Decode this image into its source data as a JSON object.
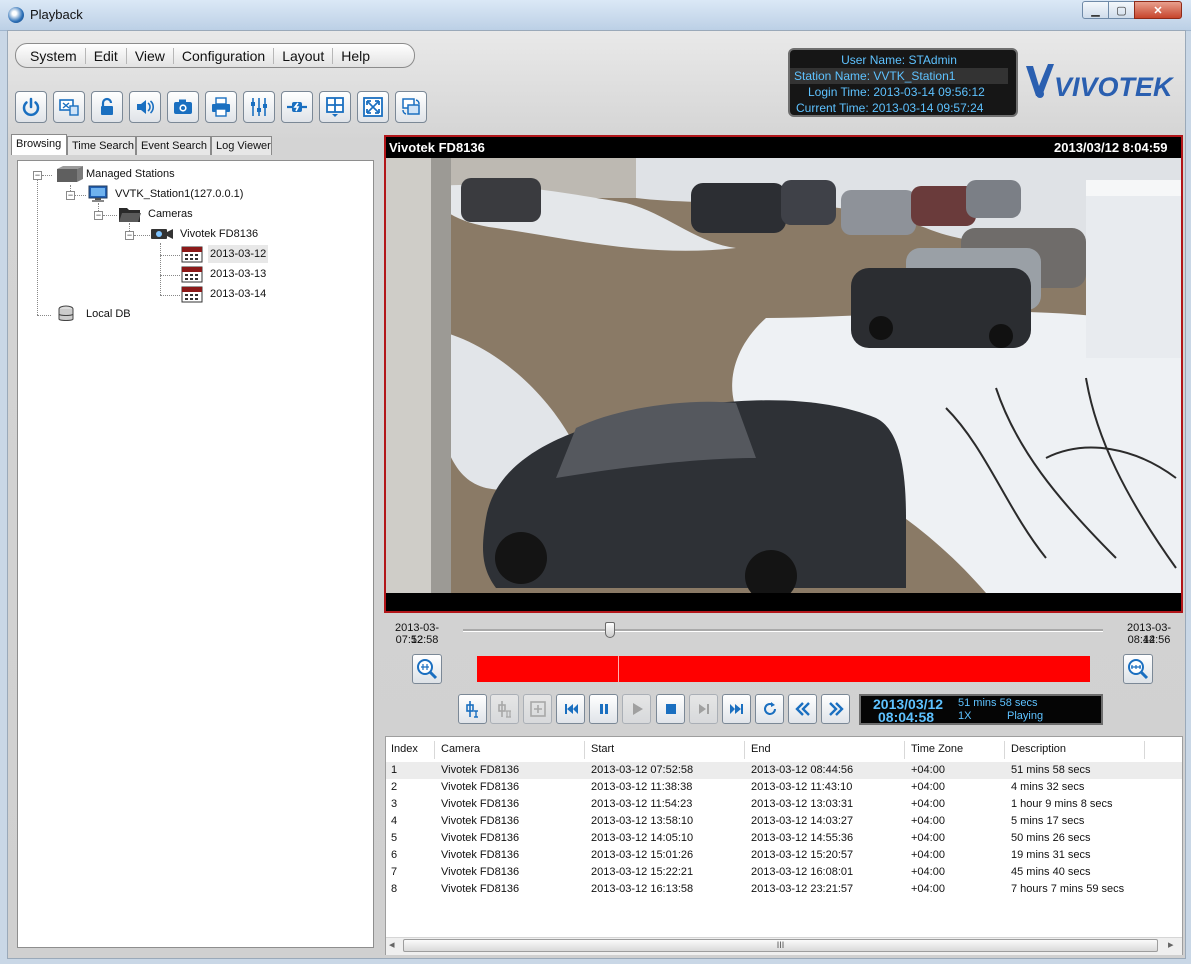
{
  "window": {
    "title": "Playback",
    "close_glyph": "✕",
    "min_glyph": "▁",
    "max_glyph": "▢"
  },
  "menu": [
    "System",
    "Edit",
    "View",
    "Configuration",
    "Layout",
    "Help"
  ],
  "toolbar_icons": [
    "power-icon",
    "station-icon",
    "lock-icon",
    "speaker-icon",
    "camera-icon",
    "print-icon",
    "filter-icon",
    "connect-icon",
    "layout-icon",
    "fullscreen-icon",
    "sync-icon"
  ],
  "user_info": {
    "user_name": "User Name: STAdmin",
    "station_name": "Station Name: VVTK_Station1",
    "login_time": "Login Time: 2013-03-14 09:56:12",
    "current_time": "Current Time: 2013-03-14 09:57:24"
  },
  "brand": {
    "name": "VIVOTEK",
    "color": "#2a5fb0"
  },
  "left_tabs": [
    "Browsing",
    "Time Search",
    "Event Search",
    "Log Viewer"
  ],
  "tree": {
    "root": "Managed Stations",
    "station": "VVTK_Station1(127.0.0.1)",
    "cameras": "Cameras",
    "camera": "Vivotek FD8136",
    "dates": [
      "2013-03-12",
      "2013-03-13",
      "2013-03-14"
    ],
    "local_db": "Local DB"
  },
  "video": {
    "camera_name": "Vivotek FD8136",
    "timestamp": "2013/03/12 8:04:59"
  },
  "timeline": {
    "start_date": "2013-03-12",
    "start_time": "07:52:58",
    "end_date": "2013-03-12",
    "end_time": "08:44:56",
    "position_fraction": 0.23
  },
  "playback_status": {
    "date": "2013/03/12",
    "time": "08:04:58",
    "duration": "51 mins 58 secs",
    "speed": "1X",
    "state": "Playing"
  },
  "table": {
    "columns": [
      "Index",
      "Camera",
      "Start",
      "End",
      "Time Zone",
      "Description"
    ],
    "rows": [
      [
        "1",
        "Vivotek FD8136",
        "2013-03-12 07:52:58",
        "2013-03-12 08:44:56",
        "+04:00",
        "51 mins 58 secs"
      ],
      [
        "2",
        "Vivotek FD8136",
        "2013-03-12 11:38:38",
        "2013-03-12 11:43:10",
        "+04:00",
        "4 mins 32 secs"
      ],
      [
        "3",
        "Vivotek FD8136",
        "2013-03-12 11:54:23",
        "2013-03-12 13:03:31",
        "+04:00",
        "1 hour 9 mins 8 secs"
      ],
      [
        "4",
        "Vivotek FD8136",
        "2013-03-12 13:58:10",
        "2013-03-12 14:03:27",
        "+04:00",
        "5 mins 17 secs"
      ],
      [
        "5",
        "Vivotek FD8136",
        "2013-03-12 14:05:10",
        "2013-03-12 14:55:36",
        "+04:00",
        "50 mins 26 secs"
      ],
      [
        "6",
        "Vivotek FD8136",
        "2013-03-12 15:01:26",
        "2013-03-12 15:20:57",
        "+04:00",
        "19 mins 31 secs"
      ],
      [
        "7",
        "Vivotek FD8136",
        "2013-03-12 15:22:21",
        "2013-03-12 16:08:01",
        "+04:00",
        "45 mins 40 secs"
      ],
      [
        "8",
        "Vivotek FD8136",
        "2013-03-12 16:13:58",
        "2013-03-12 23:21:57",
        "+04:00",
        "7 hours 7 mins 59 secs"
      ]
    ]
  },
  "scroll": {
    "left": "◂",
    "right": "▸",
    "grip": "III"
  }
}
